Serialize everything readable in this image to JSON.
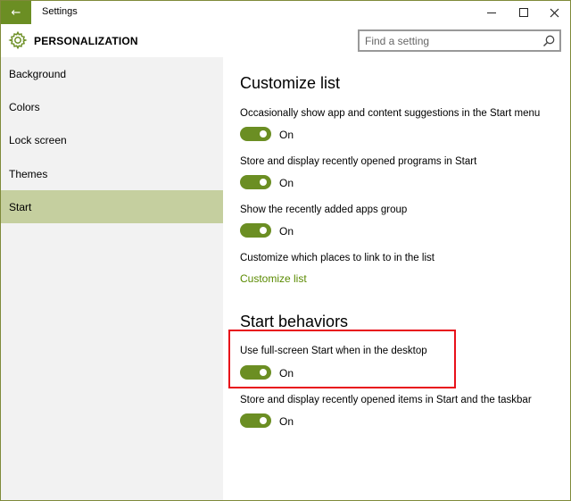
{
  "window": {
    "title": "Settings",
    "back_glyph": "🡐",
    "min_glyph": "—",
    "max_glyph": "☐",
    "close_glyph": "✕"
  },
  "header": {
    "page_title": "PERSONALIZATION",
    "search_placeholder": "Find a setting"
  },
  "sidebar": {
    "items": [
      {
        "label": "Background"
      },
      {
        "label": "Colors"
      },
      {
        "label": "Lock screen"
      },
      {
        "label": "Themes"
      },
      {
        "label": "Start"
      }
    ],
    "selected": "Start"
  },
  "main": {
    "customize_list": {
      "title": "Customize list",
      "settings": [
        {
          "label": "Occasionally show app and content suggestions in the Start menu",
          "state": "On"
        },
        {
          "label": "Store and display recently opened programs in Start",
          "state": "On"
        },
        {
          "label": "Show the recently added apps group",
          "state": "On"
        }
      ],
      "places_label": "Customize which places to link to in the list",
      "places_link": "Customize list"
    },
    "start_behaviors": {
      "title": "Start behaviors",
      "settings": [
        {
          "label": "Use full-screen Start when in the desktop",
          "state": "On"
        },
        {
          "label": "Store and display recently opened items in Start and the taskbar",
          "state": "On"
        }
      ]
    }
  },
  "colors": {
    "accent": "#6b8e23",
    "selected_nav": "#c5cf9f",
    "highlight": "#e8101a",
    "link": "#5a8a00"
  }
}
